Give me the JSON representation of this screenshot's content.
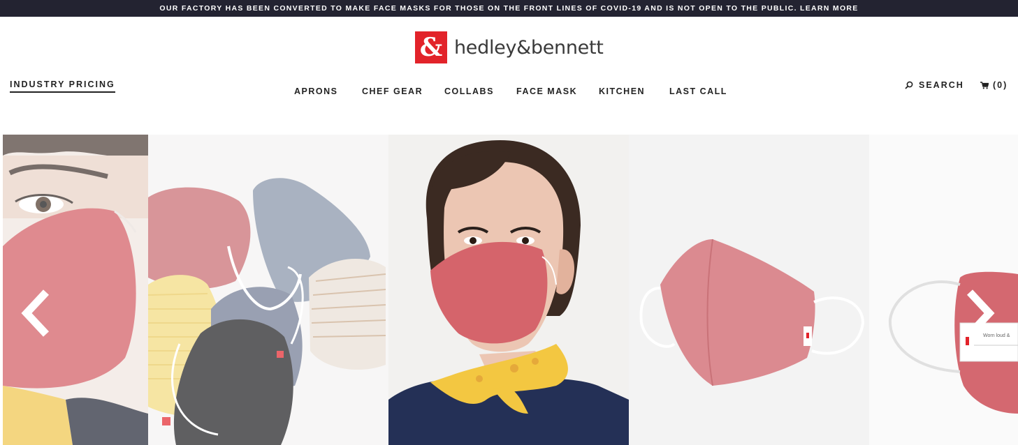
{
  "announcement": "OUR FACTORY HAS BEEN CONVERTED TO MAKE FACE MASKS FOR THOSE ON THE FRONT LINES OF COVID-19 AND IS NOT OPEN TO THE PUBLIC. LEARN MORE",
  "logo": {
    "mark": "&",
    "text": "hedley&bennett"
  },
  "header": {
    "industry_pricing": "INDUSTRY PRICING",
    "search_label": "SEARCH",
    "cart_label": "(0)"
  },
  "nav": [
    {
      "label": "APRONS"
    },
    {
      "label": "CHEF GEAR"
    },
    {
      "label": "COLLABS"
    },
    {
      "label": "FACE MASK"
    },
    {
      "label": "KITCHEN"
    },
    {
      "label": "LAST CALL"
    }
  ],
  "product_tag_text": "Worn loud &",
  "icons": {
    "search": "search-icon",
    "cart": "cart-icon",
    "prev": "chevron-left-icon",
    "next": "chevron-right-icon"
  },
  "colors": {
    "announcement_bg": "#232331",
    "brand_red": "#e2232a",
    "mask_red": "#d4676c",
    "text": "#222222"
  }
}
